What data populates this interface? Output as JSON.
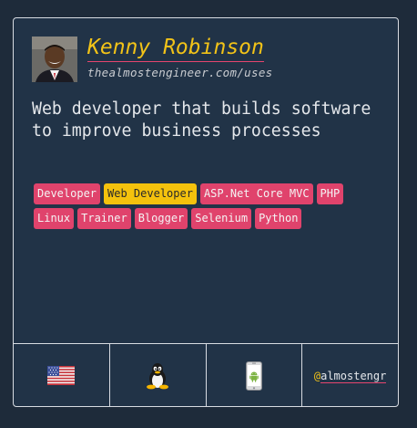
{
  "profile": {
    "name": "Kenny Robinson",
    "site": "thealmostengineer.com/uses",
    "bio": "Web developer that builds software to improve business processes"
  },
  "tags": [
    {
      "label": "Developer",
      "highlight": false
    },
    {
      "label": "Web Developer",
      "highlight": true
    },
    {
      "label": "ASP.Net Core MVC",
      "highlight": false
    },
    {
      "label": "PHP",
      "highlight": false
    },
    {
      "label": "Linux",
      "highlight": false
    },
    {
      "label": "Trainer",
      "highlight": false
    },
    {
      "label": "Blogger",
      "highlight": false
    },
    {
      "label": "Selenium",
      "highlight": false
    },
    {
      "label": "Python",
      "highlight": false
    }
  ],
  "footer": {
    "country_icon": "us-flag-icon",
    "os_icon": "linux-tux-icon",
    "phone_icon": "android-phone-icon",
    "twitter_at": "@",
    "twitter_handle": "almostengr"
  },
  "colors": {
    "background": "#1e2b3a",
    "card": "#213347",
    "accent_yellow": "#f2c318",
    "accent_pink": "#e0436c"
  }
}
